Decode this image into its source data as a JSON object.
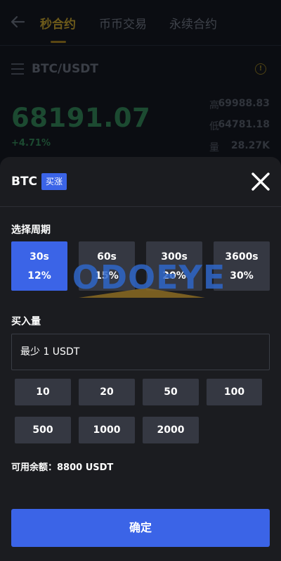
{
  "nav": {
    "tabs": [
      {
        "label": "秒合约"
      },
      {
        "label": "币币交易"
      },
      {
        "label": "永续合约"
      }
    ]
  },
  "market": {
    "pair": "BTC/USDT",
    "price": "68191.07",
    "change": "+4.71%",
    "stats": [
      {
        "label": "高",
        "value": "69988.83"
      },
      {
        "label": "低",
        "value": "64781.18"
      },
      {
        "label": "量",
        "value": "28.27K"
      }
    ]
  },
  "sheet": {
    "title": "BTC",
    "badge": "买涨",
    "period_label": "选择周期",
    "periods": [
      {
        "duration": "30s",
        "rate": "12%"
      },
      {
        "duration": "60s",
        "rate": "15%"
      },
      {
        "duration": "300s",
        "rate": "20%"
      },
      {
        "duration": "3600s",
        "rate": "30%"
      }
    ],
    "selected_period": 0,
    "watermark": "ODOEYE",
    "amount_label": "买入量",
    "amount_placeholder": "最少 1 USDT",
    "quick_amounts": [
      "10",
      "20",
      "50",
      "100",
      "500",
      "1000",
      "2000"
    ],
    "balance": "可用余额：8800 USDT",
    "confirm_label": "确定"
  },
  "colors": {
    "accent": "#3b64e7",
    "sheet_bg": "#1b1c20",
    "positive": "#1c4a31"
  }
}
